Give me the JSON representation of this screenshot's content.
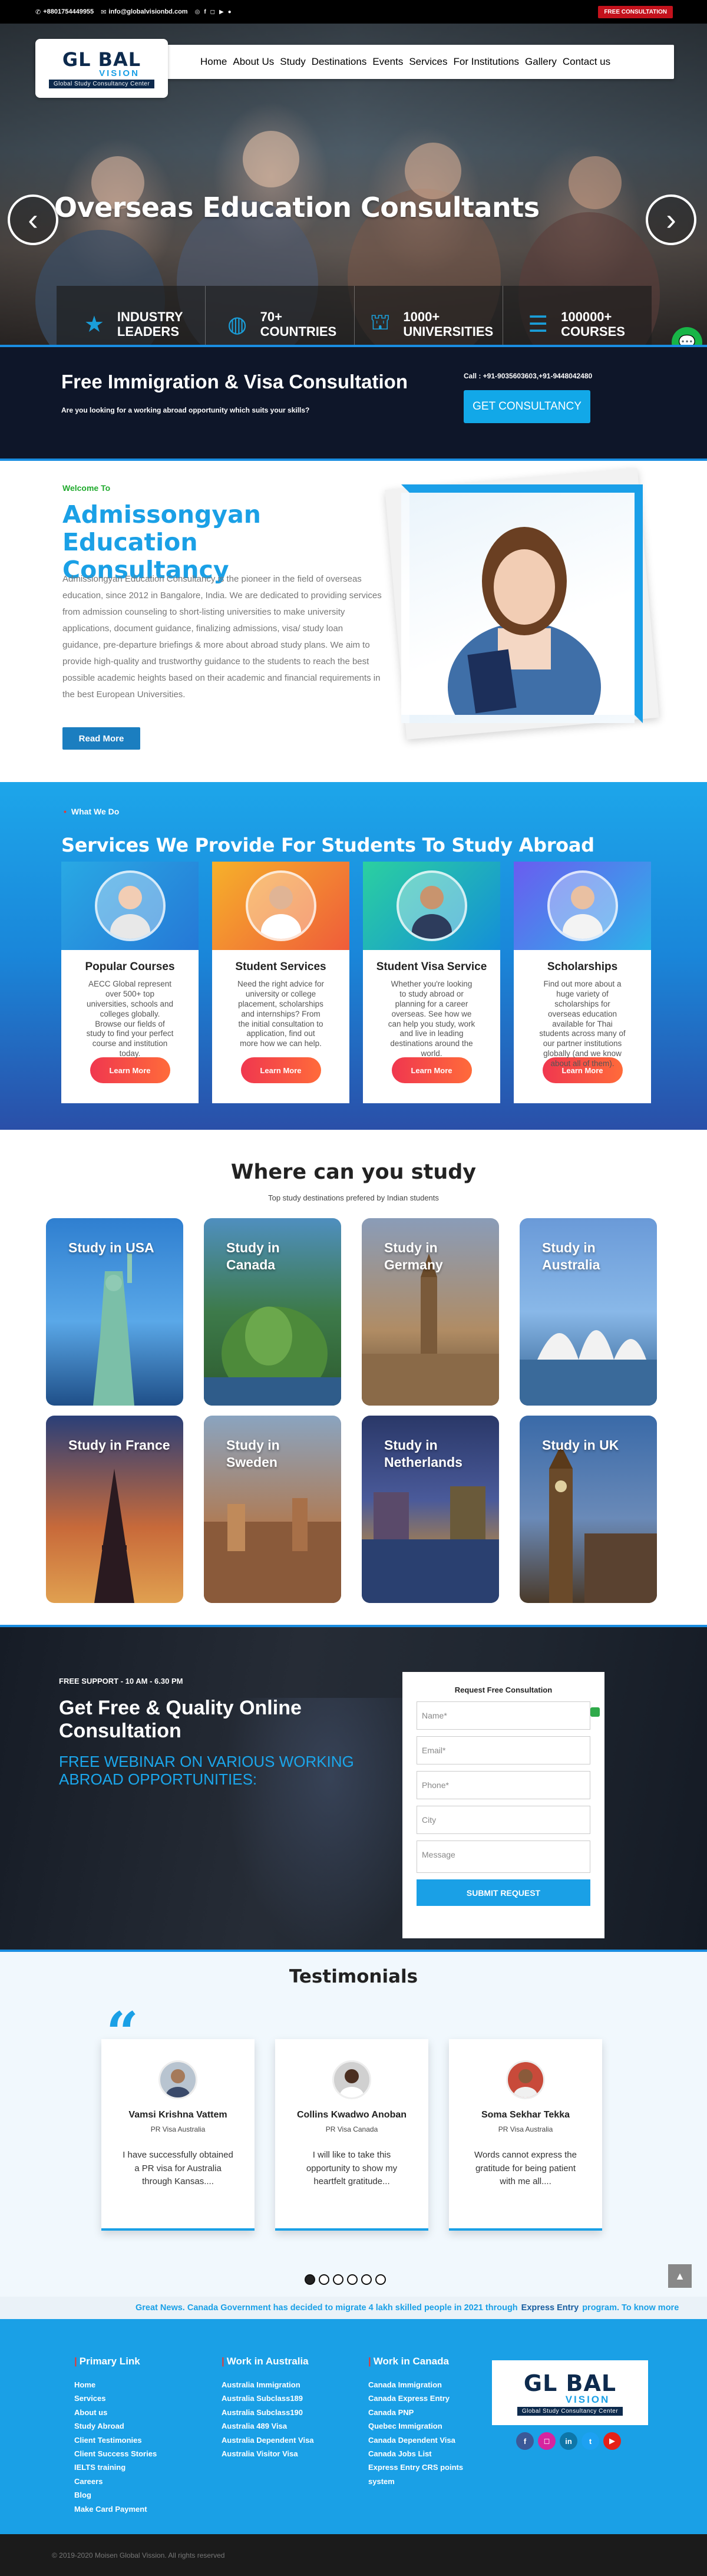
{
  "topbar": {
    "phone": "+8801754449955",
    "email": "info@globalvisionbd.com",
    "consult_button": "FREE CONSULTATION"
  },
  "logo": {
    "name": "GL  BAL",
    "vision": "VISION",
    "tagline": "Global Study Consultancy Center"
  },
  "nav": [
    "Home",
    "About Us",
    "Study",
    "Destinations",
    "Events",
    "Services",
    "For Institutions",
    "Gallery",
    "Contact us"
  ],
  "hero": {
    "title": "Overseas Education Consultants",
    "stats": [
      {
        "icon": "award-icon",
        "text": "INDUSTRY LEADERS"
      },
      {
        "icon": "globe-icon",
        "text": "70+ COUNTRIES"
      },
      {
        "icon": "graduation-cap-icon",
        "text": "1000+ UNIVERSITIES"
      },
      {
        "icon": "books-icon",
        "text": "100000+ COURSES"
      }
    ]
  },
  "consult": {
    "title": "Free Immigration & Visa Consultation",
    "subtitle": "Are you looking for a working abroad opportunity which suits your skills?",
    "call": "Call : +91-9035603603,+91-9448042480",
    "button": "GET CONSULTANCY"
  },
  "welcome": {
    "tag": "Welcome To",
    "title": "Admissongyan Education Consultancy",
    "description": "Admissiongyan Education Consultancy is the pioneer in the field of overseas education, since 2012 in Bangalore, India. We are dedicated to providing services from admission counseling to short-listing universities to make university applications, document guidance, finalizing admissions, visa/ study loan guidance, pre-departure briefings & more about abroad study plans. We aim to provide high-quality and trustworthy guidance to the students to reach the best possible academic heights based on their academic and financial requirements in the best European Universities.",
    "button": "Read More"
  },
  "services": {
    "tag": "What We Do",
    "title": "Services We Provide For Students To Study Abroad",
    "cards": [
      {
        "title": "Popular Courses",
        "text": "AECC Global represent over 500+ top universities, schools and colleges globally. Browse our fields of study to find your perfect course and institution today.",
        "button": "Learn More",
        "color1": "#29a9e4",
        "color2": "#2578d6"
      },
      {
        "title": "Student Services",
        "text": "Need the right advice for university or college placement, scholarships and internships? From the initial consultation to application, find out more how we can help.",
        "button": "Learn More",
        "color1": "#f6b12a",
        "color2": "#ef5c3a"
      },
      {
        "title": "Student Visa Service",
        "text": "Whether you're looking to study abroad or planning for a career overseas. See how we can help you study, work and live in leading destinations around the world.",
        "button": "Learn More",
        "color1": "#2bd0a0",
        "color2": "#148fd8"
      },
      {
        "title": "Scholarships",
        "text": "Find out more about a huge variety of scholarships for overseas education available for Thai students across many of our partner institutions globally (and we know about all of them).",
        "button": "Learn More",
        "color1": "#6a5cf0",
        "color2": "#2bb3e8"
      }
    ]
  },
  "study": {
    "title": "Where can you study",
    "subtitle": "Top study destinations prefered by Indian students",
    "destinations": [
      "Study in USA",
      "Study in Canada",
      "Study in Germany",
      "Study in Australia",
      "Study in France",
      "Study in Sweden",
      "Study in Netherlands",
      "Study in UK"
    ]
  },
  "webinar": {
    "support": "FREE SUPPORT - 10 AM - 6.30 PM",
    "title": "Get Free & Quality Online Consultation",
    "subtitle": "FREE WEBINAR ON VARIOUS WORKING ABROAD OPPORTUNITIES:",
    "form_title": "Request Free Consultation",
    "fields": [
      "Name*",
      "Email*",
      "Phone*",
      "City",
      "Message"
    ],
    "submit": "SUBMIT REQUEST"
  },
  "testimonials": {
    "title": "Testimonials",
    "items": [
      {
        "name": "Vamsi Krishna Vattem",
        "role": "PR Visa Australia",
        "text": "I have successfully obtained a PR visa for Australia through Kansas...."
      },
      {
        "name": "Collins Kwadwo Anoban",
        "role": "PR Visa Canada",
        "text": "I will like to take this opportunity to show my heartfelt gratitude..."
      },
      {
        "name": "Soma Sekhar Tekka",
        "role": "PR Visa Australia",
        "text": "Words cannot express the gratitude for being patient with me all...."
      }
    ]
  },
  "ticker": {
    "text": "Great News. Canada Government has decided to migrate 4 lakh skilled people in 2021 through",
    "highlight": "Express Entry",
    "end": "program. To know more"
  },
  "footer": {
    "col1": {
      "title": "Primary Link",
      "items": [
        "Home",
        "Services",
        "About us",
        "Study Abroad",
        "Client Testimonies",
        "Client Success Stories",
        "IELTS training",
        "Careers",
        "Blog",
        "Make Card Payment"
      ]
    },
    "col2": {
      "title": "Work in Australia",
      "items": [
        "Australia Immigration",
        "Australia Subclass189",
        "Australia Subclass190",
        "Australia 489 Visa",
        "Australia Dependent Visa",
        "Australia Visitor Visa"
      ]
    },
    "col3": {
      "title": "Work in Canada",
      "items": [
        "Canada Immigration",
        "Canada Express Entry",
        "Canada PNP",
        "Quebec Immigration",
        "Canada Dependent Visa",
        "Canada Jobs List",
        "Express Entry CRS points",
        "system"
      ]
    },
    "copyright": "© 2019-2020 Moisen Global Vission. All rights reserved"
  }
}
